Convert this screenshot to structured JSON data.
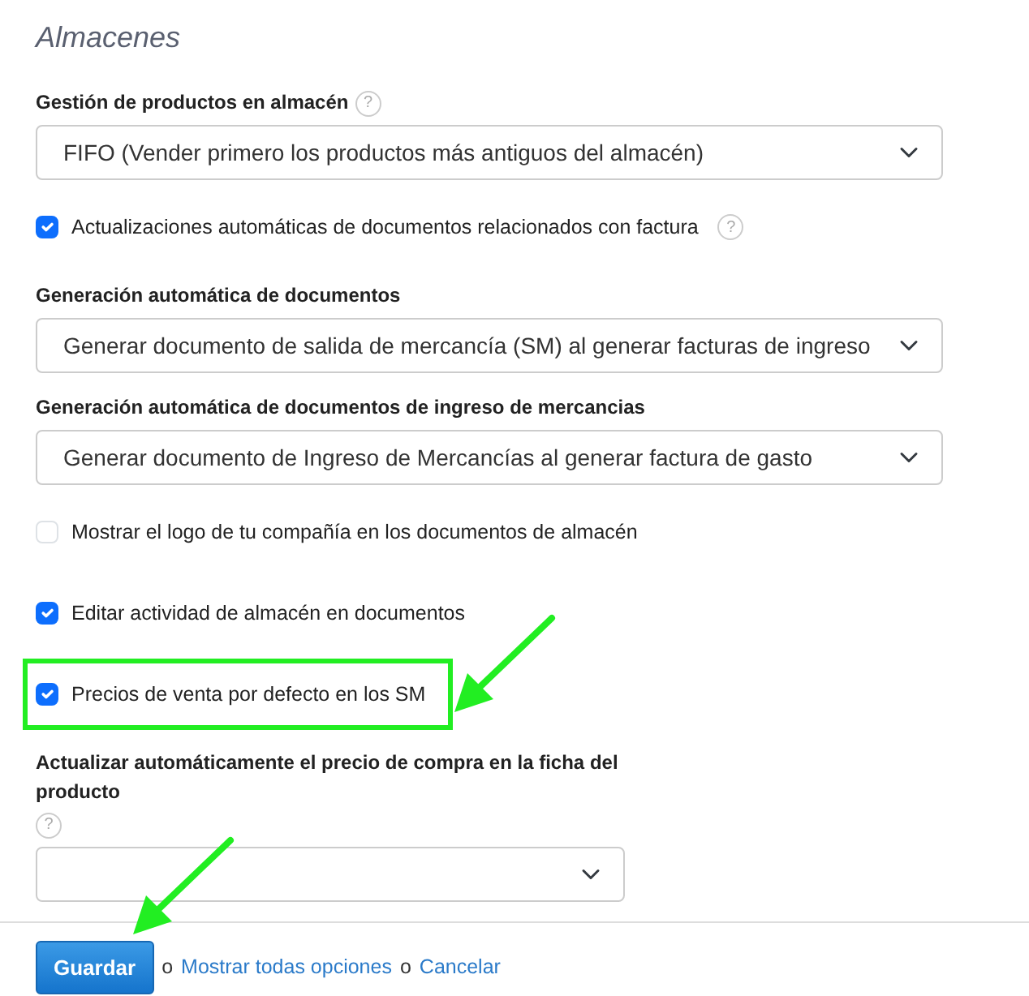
{
  "section": {
    "title": "Almacenes"
  },
  "fields": [
    {
      "kind": "select",
      "label": "Gestión de productos en almacén",
      "help": "?",
      "value": "FIFO (Vender primero los productos más antiguos del almacén)",
      "wide": true
    },
    {
      "kind": "checkbox",
      "label": "Actualizaciones automáticas de documentos relacionados con factura",
      "help": "?",
      "checked": true,
      "highlighted": false,
      "arrow": false
    },
    {
      "kind": "select",
      "label": "Generación automática de documentos",
      "value": "Generar documento de salida de mercancía (SM) al generar facturas de ingreso",
      "wide": true
    },
    {
      "kind": "select",
      "label": "Generación automática de documentos de ingreso de mercancias",
      "value": "Generar documento de Ingreso de Mercancías al generar factura de gasto",
      "wide": true
    },
    {
      "kind": "checkbox",
      "label": "Mostrar el logo de tu compañía en los documentos de almacén",
      "checked": false,
      "highlighted": false,
      "arrow": false
    },
    {
      "kind": "checkbox",
      "label": "Editar actividad de almacén en documentos",
      "checked": true,
      "highlighted": false,
      "arrow": false
    },
    {
      "kind": "checkbox",
      "label": "Precios de venta por defecto en los SM",
      "checked": true,
      "highlighted": true,
      "arrow": true
    },
    {
      "kind": "select",
      "label": "Actualizar automáticamente el precio de compra en la ficha del producto",
      "help": "?",
      "help_below": true,
      "wide": false
    }
  ],
  "footer": {
    "save": {
      "label": "Guardar",
      "arrow": true
    },
    "sep1": "o",
    "show_all": "Mostrar todas opciones",
    "sep2": "o",
    "cancel": "Cancelar"
  }
}
